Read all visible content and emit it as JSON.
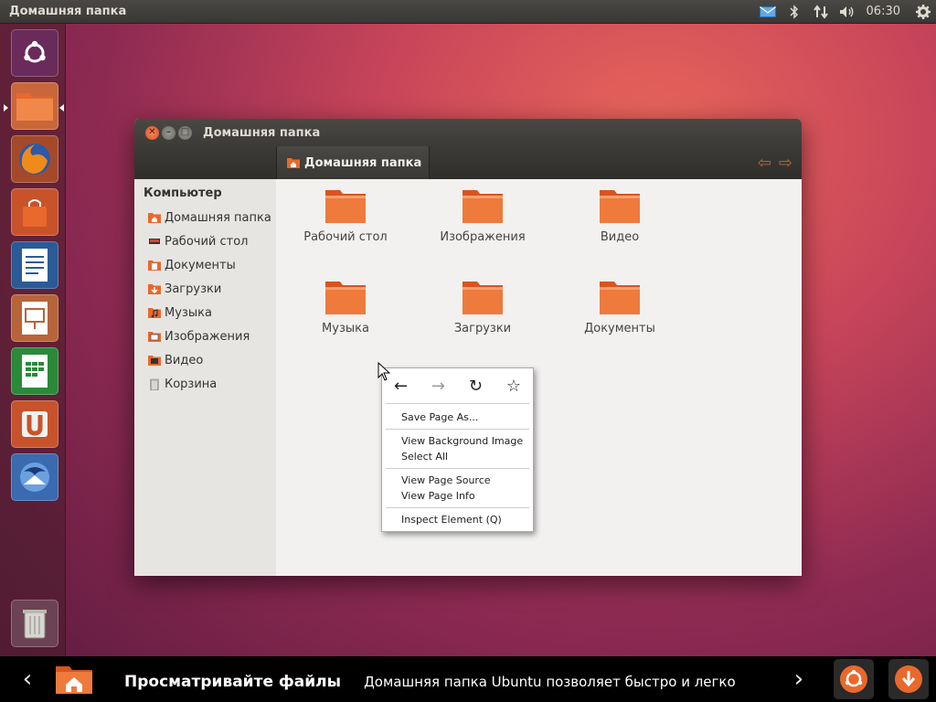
{
  "top_panel": {
    "title": "Домашняя папка",
    "clock": "06:30"
  },
  "launcher": {
    "items": [
      {
        "name": "ubuntu-dash"
      },
      {
        "name": "files"
      },
      {
        "name": "firefox"
      },
      {
        "name": "software-center"
      },
      {
        "name": "libreoffice-writer"
      },
      {
        "name": "libreoffice-impress"
      },
      {
        "name": "libreoffice-calc"
      },
      {
        "name": "ubuntu-one"
      },
      {
        "name": "thunderbird"
      },
      {
        "name": "trash"
      }
    ]
  },
  "window": {
    "title": "Домашняя папка",
    "breadcrumb": "Домашняя папка",
    "sidebar": {
      "header": "Компьютер",
      "items": [
        {
          "label": "Домашняя папка",
          "icon": "home-folder-icon"
        },
        {
          "label": "Рабочий стол",
          "icon": "desktop-icon"
        },
        {
          "label": "Документы",
          "icon": "documents-folder-icon"
        },
        {
          "label": "Загрузки",
          "icon": "downloads-folder-icon"
        },
        {
          "label": "Музыка",
          "icon": "music-folder-icon"
        },
        {
          "label": "Изображения",
          "icon": "pictures-folder-icon"
        },
        {
          "label": "Видео",
          "icon": "videos-folder-icon"
        },
        {
          "label": "Корзина",
          "icon": "trash-icon"
        }
      ]
    },
    "folders": [
      {
        "label": "Рабочий стол"
      },
      {
        "label": "Изображения"
      },
      {
        "label": "Видео"
      },
      {
        "label": "Музыка"
      },
      {
        "label": "Загрузки"
      },
      {
        "label": "Документы"
      }
    ]
  },
  "context_menu": {
    "icons": [
      "back-arrow-icon",
      "forward-arrow-icon",
      "reload-icon",
      "bookmark-star-icon"
    ],
    "items": [
      "Save Page As...",
      "View Background Image",
      "Select All",
      "View Page Source",
      "View Page Info",
      "Inspect Element (Q)"
    ]
  },
  "bottom_bar": {
    "heading": "Просматривайте файлы",
    "description": "Домашняя папка Ubuntu позволяет быстро и легко"
  },
  "colors": {
    "accent_orange": "#e9682c",
    "panel_dark": "#3c3b37"
  }
}
